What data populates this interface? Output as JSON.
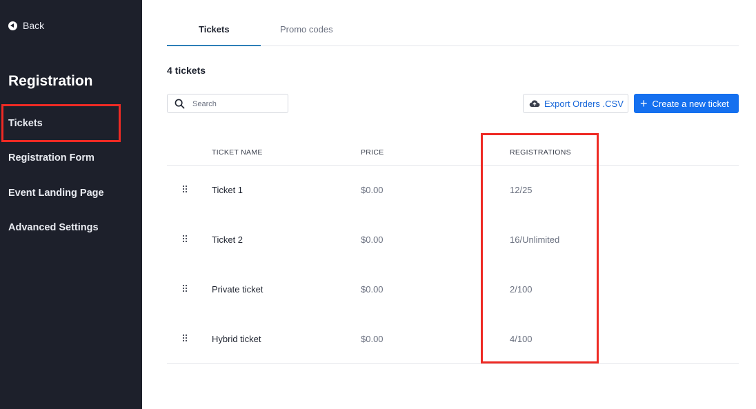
{
  "sidebar": {
    "back_label": "Back",
    "title": "Registration",
    "items": [
      {
        "label": "Tickets"
      },
      {
        "label": "Registration Form"
      },
      {
        "label": "Event Landing Page"
      },
      {
        "label": "Advanced Settings"
      }
    ]
  },
  "tabs": [
    {
      "label": "Tickets",
      "active": true
    },
    {
      "label": "Promo codes",
      "active": false
    }
  ],
  "ticket_count": "4 tickets",
  "search": {
    "placeholder": "Search",
    "value": ""
  },
  "toolbar": {
    "export_label": "Export Orders .CSV",
    "create_label": "Create a new ticket"
  },
  "table": {
    "headers": [
      "TICKET NAME",
      "PRICE",
      "REGISTRATIONS"
    ],
    "rows": [
      {
        "name": "Ticket 1",
        "price": "$0.00",
        "registrations": "12/25"
      },
      {
        "name": "Ticket 2",
        "price": "$0.00",
        "registrations": "16/Unlimited"
      },
      {
        "name": "Private ticket",
        "price": "$0.00",
        "registrations": "2/100"
      },
      {
        "name": "Hybrid ticket",
        "price": "$0.00",
        "registrations": "4/100"
      }
    ]
  },
  "colors": {
    "sidebar_bg": "#1d202b",
    "primary": "#1570ef",
    "link": "#1565d8",
    "annotation": "#ee2a24"
  },
  "icons": [
    "back-icon",
    "search-icon",
    "cloud-upload-icon",
    "plus-icon",
    "drag-handle-icon"
  ]
}
